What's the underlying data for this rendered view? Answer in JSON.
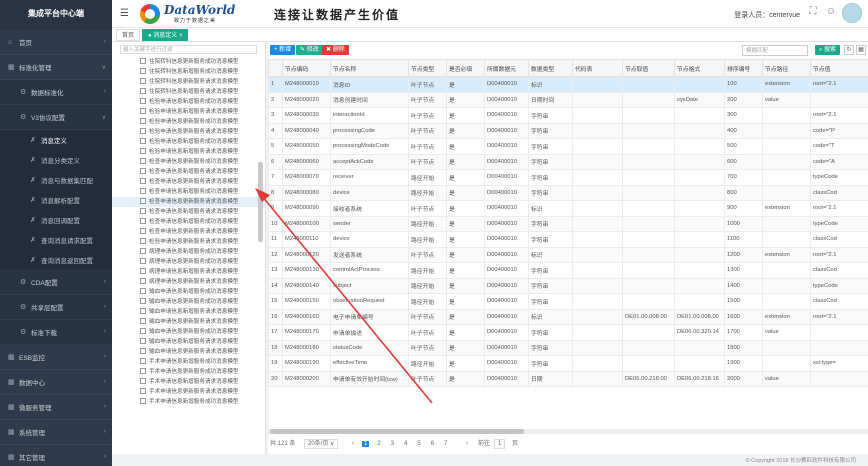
{
  "sidebar": {
    "brand": "集成平台中心端",
    "items": [
      {
        "label": "首页",
        "icon": "home-icon",
        "level": 1
      },
      {
        "label": "标准化管理",
        "icon": "grid-icon",
        "level": 1,
        "expanded": true
      },
      {
        "label": "数据标准化",
        "icon": "gear-icon",
        "level": 2
      },
      {
        "label": "V3协议配置",
        "icon": "gear-icon",
        "level": 2,
        "expanded": true
      },
      {
        "label": "消息定义",
        "icon": "tool-icon",
        "level": 3,
        "active": true
      },
      {
        "label": "消息分类定义",
        "icon": "tool-icon",
        "level": 3
      },
      {
        "label": "消息与数据集匹配",
        "icon": "tool-icon",
        "level": 3
      },
      {
        "label": "消息解析配置",
        "icon": "tool-icon",
        "level": 3
      },
      {
        "label": "消息回调配置",
        "icon": "tool-icon",
        "level": 3
      },
      {
        "label": "查询消息请求配置",
        "icon": "tool-icon",
        "level": 3
      },
      {
        "label": "查询消息返回配置",
        "icon": "tool-icon",
        "level": 3
      },
      {
        "label": "CDA配置",
        "icon": "gear-icon",
        "level": 2
      },
      {
        "label": "共享层配置",
        "icon": "gear-icon",
        "level": 2
      },
      {
        "label": "标准下载",
        "icon": "gear-icon",
        "level": 2
      },
      {
        "label": "ESB监控",
        "icon": "grid-icon",
        "level": 1
      },
      {
        "label": "数据中心",
        "icon": "grid-icon",
        "level": 1
      },
      {
        "label": "微服务管理",
        "icon": "grid-icon",
        "level": 1
      },
      {
        "label": "系统管理",
        "icon": "grid-icon",
        "level": 1
      },
      {
        "label": "其它管理",
        "icon": "grid-icon",
        "level": 1
      }
    ]
  },
  "header": {
    "logo_text": "DataWorld",
    "logo_sub": "致力于数据之美",
    "slogan": "连接让数据产生价值",
    "user_label": "登录人员：",
    "user_name": "centervue"
  },
  "tabs": [
    {
      "label": "首页",
      "active": false
    },
    {
      "label": "● 消息定义 ×",
      "active": true
    }
  ],
  "tree": {
    "search_placeholder": "输入关键字进行过滤",
    "items": [
      "住院转科信息更新服务成功消息模型",
      "住院转科信息新增服务成功消息模型",
      "住院转科信息更新服务请求消息模型",
      "住院转科信息新增服务请求消息模型",
      "检验申请信息新增服务成功消息模型",
      "检验申请信息新增服务请求消息模型",
      "检验申请信息更新服务成功消息模型",
      "检验申请信息更新服务请求消息模型",
      "检验申请信息新增服务成功消息模型",
      "检验申请信息新增服务请求消息模型",
      "检查申请信息更新服务成功消息模型",
      "检查申请信息新增服务请求消息模型",
      "检查申请信息更新服务请求消息模型",
      "检查申请信息新增服务成功消息模型",
      "检查申请信息更新服务请求消息模型",
      "检查申请信息新增服务请求消息模型",
      "检查申请信息新增服务成功消息模型",
      "检查申请信息更新服务请求消息模型",
      "检验申请信息更新服务请求消息模型",
      "病理申请信息新增服务成功消息模型",
      "病理申请信息更新服务成功消息模型",
      "病理申请信息新增服务请求消息模型",
      "病理申请信息更新服务请求消息模型",
      "输血申请信息新增服务成功消息模型",
      "输血申请信息更新服务成功消息模型",
      "输血申请信息新增服务请求消息模型",
      "输血申请信息更新服务请求消息模型",
      "输血申请信息更新服务成功消息模型",
      "输血申请信息新增服务请求消息模型",
      "输血申请信息更新服务请求消息模型",
      "手术申请信息新增服务成功消息模型",
      "手术申请信息更新服务成功消息模型",
      "手术申请信息新增服务请求消息模型",
      "手术申请信息更新服务请求消息模型",
      "手术申请信息新增服务成功消息模型"
    ],
    "selected_index": 14
  },
  "toolbar": {
    "add_label": "+ 新增",
    "edit_label": "✎ 修改",
    "delete_label": "✖ 删除",
    "search_placeholder": "模糊匹配",
    "search_label": "⌕ 搜索"
  },
  "table": {
    "columns": [
      "",
      "节点编码",
      "节点名称",
      "节点类型",
      "是否必填",
      "所属数据元",
      "数据类型",
      "代码表",
      "节点取值",
      "节点格式",
      "排序编号",
      "节点路径",
      "节点值"
    ],
    "rows": [
      [
        "1",
        "M248000010",
        "消息ID",
        "叶子节点",
        "是",
        "D00400010",
        "标识",
        "",
        "",
        "",
        "100",
        "extension",
        "root=\"2.1"
      ],
      [
        "2",
        "M248000020",
        "消息创建时间",
        "叶子节点",
        "是",
        "D00400010",
        "日期时间",
        "",
        "",
        "sysDate",
        "200",
        "value",
        ""
      ],
      [
        "3",
        "M248000030",
        "interactionId",
        "叶子节点",
        "是",
        "D00400010",
        "字符串",
        "",
        "",
        "",
        "300",
        "",
        "root=\"2.1"
      ],
      [
        "4",
        "M248000040",
        "processingCode",
        "叶子节点",
        "是",
        "D00400010",
        "字符串",
        "",
        "",
        "",
        "400",
        "",
        "code=\"P"
      ],
      [
        "5",
        "M248000050",
        "processingModeCode",
        "叶子节点",
        "是",
        "D00400010",
        "字符串",
        "",
        "",
        "",
        "500",
        "",
        "code=\"T"
      ],
      [
        "6",
        "M248000060",
        "acceptAckCode",
        "叶子节点",
        "是",
        "D00400010",
        "字符串",
        "",
        "",
        "",
        "600",
        "",
        "code=\"A"
      ],
      [
        "7",
        "M248000070",
        "receiver",
        "路径开始",
        "是",
        "D00400010",
        "字符串",
        "",
        "",
        "",
        "700",
        "",
        "typeCode"
      ],
      [
        "8",
        "M248000080",
        "device",
        "路径开始",
        "是",
        "D00400010",
        "字符串",
        "",
        "",
        "",
        "800",
        "",
        "classCod"
      ],
      [
        "9",
        "M248000090",
        "接收者系统",
        "叶子节点",
        "是",
        "D00400010",
        "标识",
        "",
        "",
        "",
        "900",
        "extension",
        "root=\"2.1"
      ],
      [
        "10",
        "M248000100",
        "sender",
        "路径开始",
        "是",
        "D00400010",
        "字符串",
        "",
        "",
        "",
        "1000",
        "",
        "typeCode"
      ],
      [
        "11",
        "M248000110",
        "device",
        "路径开始",
        "是",
        "D00400010",
        "字符串",
        "",
        "",
        "",
        "1100",
        "",
        "classCod"
      ],
      [
        "12",
        "M248000120",
        "发送者系统",
        "叶子节点",
        "是",
        "D00400010",
        "标识",
        "",
        "",
        "",
        "1200",
        "extension",
        "root=\"2.1"
      ],
      [
        "13",
        "M248000130",
        "controlActProcess",
        "路径开始",
        "是",
        "D00400010",
        "字符串",
        "",
        "",
        "",
        "1300",
        "",
        "classCod"
      ],
      [
        "14",
        "M248000140",
        "subject",
        "路径开始",
        "是",
        "D00400010",
        "字符串",
        "",
        "",
        "",
        "1400",
        "",
        "typeCode"
      ],
      [
        "15",
        "M248000150",
        "observationRequest",
        "路径开始",
        "是",
        "D00400010",
        "字符串",
        "",
        "",
        "",
        "1500",
        "",
        "classCod"
      ],
      [
        "16",
        "M248000160",
        "电子申请单编号",
        "叶子节点",
        "是",
        "D00400010",
        "标识",
        "",
        "DE01.00.008.00",
        "DE01.00.008.00",
        "1600",
        "extension",
        "root=\"2.1"
      ],
      [
        "17",
        "M248000170",
        "申请单描述",
        "叶子节点",
        "是",
        "D00400010",
        "字符串",
        "",
        "",
        "DE06.00.320.14",
        "1700",
        "value",
        ""
      ],
      [
        "18",
        "M248000180",
        "statusCode",
        "叶子节点",
        "是",
        "D00400010",
        "字符串",
        "",
        "",
        "",
        "1800",
        "",
        ""
      ],
      [
        "19",
        "M248000190",
        "effectiveTime",
        "路径开始",
        "是",
        "D00400010",
        "字符串",
        "",
        "",
        "",
        "1900",
        "",
        "xsi:type="
      ],
      [
        "20",
        "M248000200",
        "申请单有效开始时间(low)",
        "叶子节点",
        "是",
        "D00400010",
        "日期",
        "",
        "DE06.00.218.00",
        "DE06.00.218.16",
        "2000",
        "value",
        ""
      ]
    ],
    "selected_row": 0
  },
  "pager": {
    "total": "共 121 条",
    "page_size": "20条/页 ∨",
    "prev": "‹",
    "pages": [
      "1",
      "2",
      "3",
      "4",
      "5",
      "6",
      "7"
    ],
    "current_page": "1",
    "next": "›",
    "goto_label": "前往",
    "goto_value": "1",
    "page_unit": "页"
  },
  "footer": {
    "copyright": "© Copyright 2018 长沙赛匹软件科技有限公司"
  },
  "colors": {
    "sidebar_bg": "#2f3b4c",
    "accent_blue": "#1e88e5",
    "accent_green": "#1aaa8a",
    "danger_red": "#e53935",
    "annotation_arrow": "#e53935"
  }
}
